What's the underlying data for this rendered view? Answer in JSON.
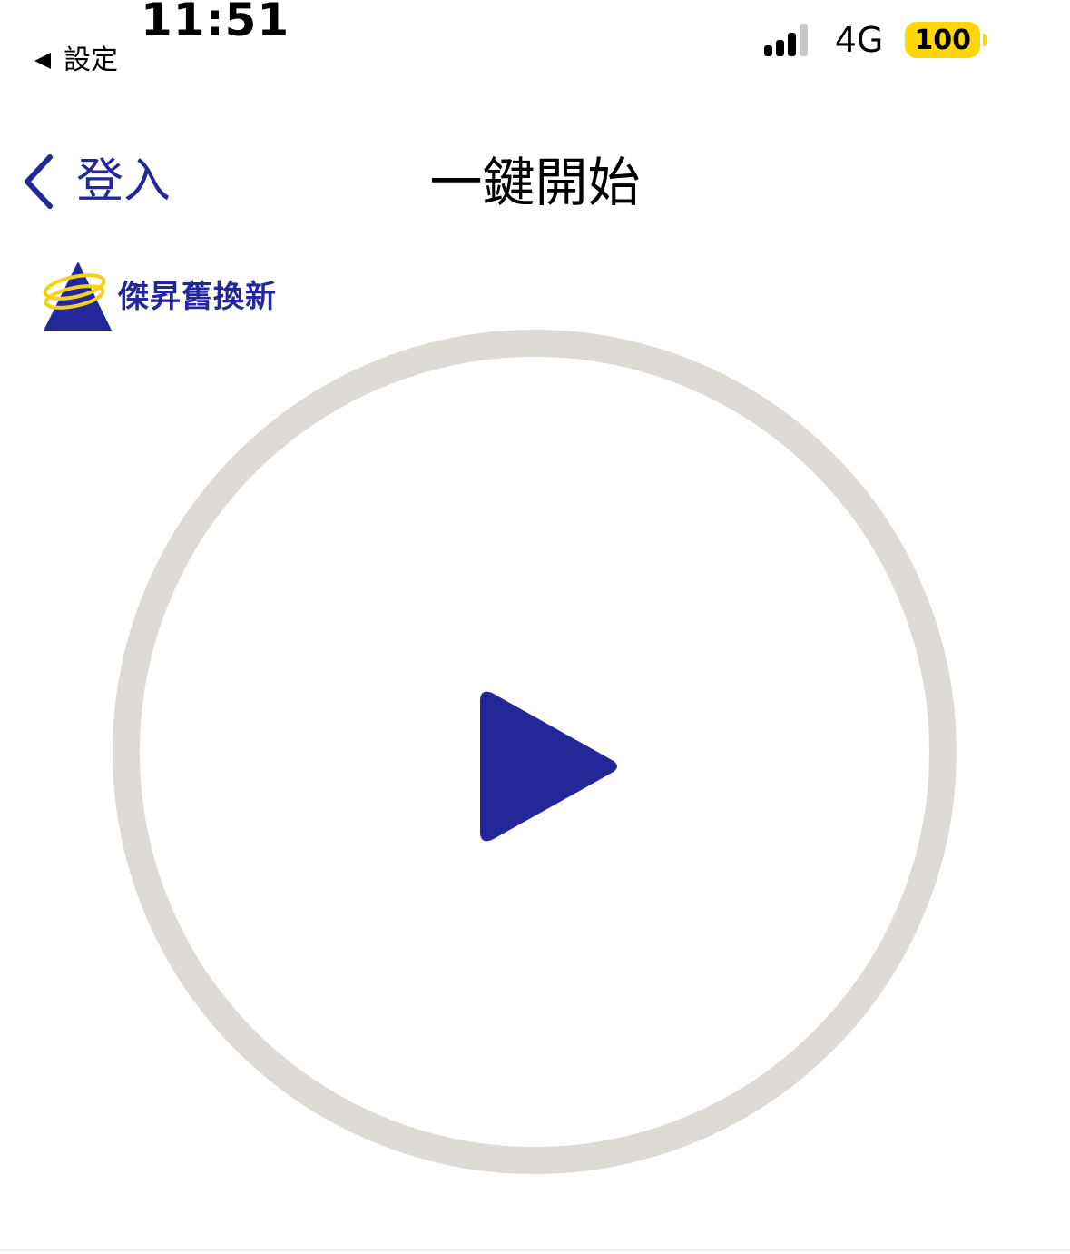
{
  "status_bar": {
    "time": "11:51",
    "back_label": "設定",
    "network": "4G",
    "battery": "100",
    "battery_color": "#ffd60a"
  },
  "nav": {
    "back_label": "登入",
    "title": "一鍵開始",
    "accent_color": "#24279a"
  },
  "logo": {
    "text": "傑昇舊換新",
    "icon": "triangle-halo-logo-icon"
  },
  "main": {
    "play_icon": "play-icon",
    "ring_color": "#dedad5",
    "play_color": "#24279a"
  }
}
